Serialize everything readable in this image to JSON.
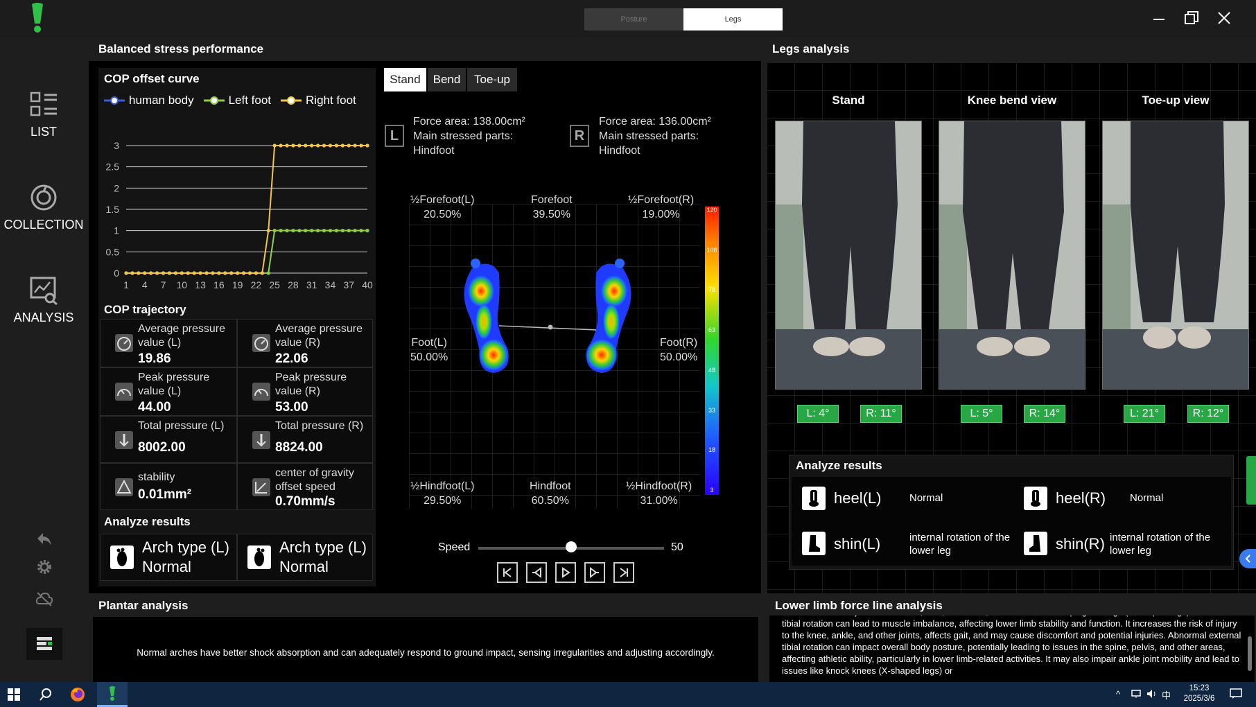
{
  "window": {
    "mode_tabs": [
      "Posture",
      "Legs"
    ],
    "active_mode_tab": "Legs"
  },
  "sidebar": {
    "items": [
      {
        "label": "LIST",
        "icon": "list-icon"
      },
      {
        "label": "COLLECTION",
        "icon": "collection-icon"
      },
      {
        "label": "ANALYSIS",
        "icon": "analysis-icon"
      }
    ],
    "bottom_icons": [
      "undo-icon",
      "settings-icon",
      "cloud-off-icon",
      "report-icon"
    ]
  },
  "balanced": {
    "title": "Balanced stress performance",
    "cop_curve": {
      "title": "COP offset curve",
      "legend": [
        "human body",
        "Left foot",
        "Right foot"
      ]
    },
    "cop_trajectory": {
      "title": "COP trajectory",
      "cells": [
        {
          "label": "Average pressure value (L)",
          "value": "19.86"
        },
        {
          "label": "Average pressure value (R)",
          "value": "22.06"
        },
        {
          "label": "Peak pressure value (L)",
          "value": "44.00"
        },
        {
          "label": "Peak pressure value (R)",
          "value": "53.00"
        },
        {
          "label": "Total pressure (L)",
          "value": "8002.00"
        },
        {
          "label": "Total pressure (R)",
          "value": "8824.00"
        },
        {
          "label": "stability",
          "value": "0.01mm²"
        },
        {
          "label": "center of gravity offset speed",
          "value": "0.70mm/s"
        }
      ]
    },
    "analyze": {
      "title": "Analyze results",
      "items": [
        {
          "label": "Arch type (L)",
          "value": "Normal"
        },
        {
          "label": "Arch type (L)",
          "value": "Normal"
        }
      ]
    },
    "tabs": [
      "Stand",
      "Bend",
      "Toe-up"
    ],
    "active_tab": "Stand",
    "left_foot": {
      "badge": "L",
      "force_area": "Force area:  138.00cm²",
      "main_label": "Main stressed parts:",
      "main_value": "Hindfoot"
    },
    "right_foot": {
      "badge": "R",
      "force_area": "Force area:  136.00cm²",
      "main_label": "Main stressed parts:",
      "main_value": "Hindfoot"
    },
    "regions": {
      "half_forefoot_l": {
        "name": "½Forefoot(L)",
        "value": "20.50%"
      },
      "forefoot": {
        "name": "Forefoot",
        "value": "39.50%"
      },
      "half_forefoot_r": {
        "name": "½Forefoot(R)",
        "value": "19.00%"
      },
      "foot_l": {
        "name": "Foot(L)",
        "value": "50.00%"
      },
      "foot_r": {
        "name": "Foot(R)",
        "value": "50.00%"
      },
      "half_hindfoot_l": {
        "name": "½Hindfoot(L)",
        "value": "29.50%"
      },
      "hindfoot": {
        "name": "Hindfoot",
        "value": "60.50%"
      },
      "half_hindfoot_r": {
        "name": "½Hindfoot(R)",
        "value": "31.00%"
      }
    },
    "color_scale": [
      "120",
      "108",
      "78",
      "63",
      "48",
      "33",
      "18",
      "3"
    ],
    "speed": {
      "label": "Speed",
      "value": "50",
      "fraction": 0.5
    }
  },
  "legs": {
    "title": "Legs analysis",
    "views": [
      {
        "title": "Stand",
        "left": "L:  4°",
        "right": "R:  11°"
      },
      {
        "title": "Knee bend view",
        "left": "L:  5°",
        "right": "R:  14°"
      },
      {
        "title": "Toe-up view",
        "left": "L:  21°",
        "right": "R:  12°"
      }
    ],
    "analyze": {
      "title": "Analyze results",
      "items": [
        {
          "part": "heel(L)",
          "result": "Normal"
        },
        {
          "part": "heel(R)",
          "result": "Normal"
        },
        {
          "part": "shin(L)",
          "result": "internal rotation of the lower leg"
        },
        {
          "part": "shin(R)",
          "result": "internal rotation of the lower leg"
        }
      ]
    }
  },
  "plantar": {
    "title": "Plantar analysis",
    "text": "Normal arches have better shock absorption and can adequately respond to ground impact, sensing irregularities and adjusting accordingly."
  },
  "lower_limb": {
    "title": "Lower limb force line analysis",
    "text": "This can lead to injuries in the sole, tibia, and ankle, with a risk of developing bowlegs (O-shaped legs). External tibial rotation can lead to muscle imbalance, affecting lower limb stability and function. It increases the risk of injury to the knee, ankle, and other joints, affects gait, and may cause discomfort and potential injuries. Abnormal external tibial rotation can impact overall body posture, potentially leading to issues in the spine, pelvis, and other areas, affecting athletic ability, particularly in lower limb-related activities. It may also impair ankle joint mobility and lead to issues like knock knees (X-shaped legs) or"
  },
  "taskbar": {
    "time": "15:23",
    "date": "2025/3/6",
    "ime": "中"
  },
  "chart_data": {
    "type": "line",
    "title": "COP offset curve",
    "x": [
      1,
      2,
      3,
      4,
      5,
      6,
      7,
      8,
      9,
      10,
      11,
      12,
      13,
      14,
      15,
      16,
      17,
      18,
      19,
      20,
      21,
      22,
      23,
      24,
      25,
      26,
      27,
      28,
      29,
      30,
      31,
      32,
      33,
      34,
      35,
      36,
      37,
      38,
      39,
      40
    ],
    "x_ticks": [
      "1",
      "4",
      "7",
      "10",
      "13",
      "16",
      "19",
      "22",
      "25",
      "28",
      "31",
      "34",
      "37",
      "40"
    ],
    "y_ticks": [
      "0",
      "0.5",
      "1",
      "1.5",
      "2",
      "2.5",
      "3"
    ],
    "ylim": [
      0,
      3
    ],
    "series": [
      {
        "name": "human body",
        "color": "#3b5bdb",
        "values": [
          0,
          0,
          0,
          0,
          0,
          0,
          0,
          0,
          0,
          0,
          0,
          0,
          0,
          0,
          0,
          0,
          0,
          0,
          0,
          0,
          0,
          0,
          0,
          0,
          1,
          1,
          1,
          1,
          1,
          1,
          1,
          1,
          1,
          1,
          1,
          1,
          1,
          1,
          1,
          1
        ]
      },
      {
        "name": "Left foot",
        "color": "#8fcf3f",
        "values": [
          0,
          0,
          0,
          0,
          0,
          0,
          0,
          0,
          0,
          0,
          0,
          0,
          0,
          0,
          0,
          0,
          0,
          0,
          0,
          0,
          0,
          0,
          0,
          0,
          1,
          1,
          1,
          1,
          1,
          1,
          1,
          1,
          1,
          1,
          1,
          1,
          1,
          1,
          1,
          1
        ]
      },
      {
        "name": "Right foot",
        "color": "#f2c744",
        "values": [
          0,
          0,
          0,
          0,
          0,
          0,
          0,
          0,
          0,
          0,
          0,
          0,
          0,
          0,
          0,
          0,
          0,
          0,
          0,
          0,
          0,
          0,
          0,
          1,
          3,
          3,
          3,
          3,
          3,
          3,
          3,
          3,
          3,
          3,
          3,
          3,
          3,
          3,
          3,
          3
        ]
      }
    ]
  }
}
